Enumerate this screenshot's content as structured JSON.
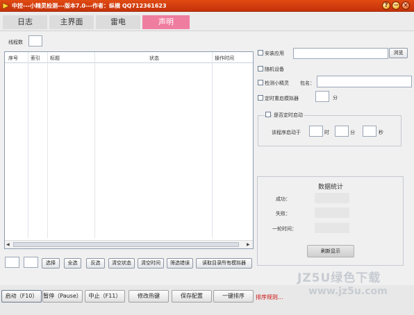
{
  "window": {
    "title": "中控---小精灵检测---版本7.0---作者：纵横 QQ712361623",
    "title_color": "#d63c0c"
  },
  "tabs": [
    {
      "label": "日志",
      "active": false
    },
    {
      "label": "主界面",
      "active": false
    },
    {
      "label": "雷电",
      "active": false
    },
    {
      "label": "声明",
      "active": true
    }
  ],
  "threads": {
    "label": "线程数",
    "value": ""
  },
  "table": {
    "columns": [
      "序号",
      "索引",
      "标题",
      "状态",
      "操作时间"
    ],
    "rows": []
  },
  "options": {
    "install_app": {
      "label": "安装应用",
      "checked": false,
      "value": ""
    },
    "browse_button": "浏览",
    "random_device": {
      "label": "随机设备",
      "checked": false
    },
    "detect_sprite": {
      "label": "检测小精灵",
      "checked": false,
      "pkg_label": "包名：",
      "pkg_value": ""
    },
    "timed_restart": {
      "label": "定时重启模拟器",
      "checked": false,
      "value": "",
      "unit": "分"
    }
  },
  "schedule": {
    "label": "是否定时启动",
    "checked": false,
    "prefix": "该程序启动于",
    "hour_unit": "时",
    "minute_unit": "分",
    "second_unit": "秒"
  },
  "stats": {
    "title": "数据统计",
    "success_label": "成功：",
    "fail_label": "失败：",
    "round_time_label": "一轮时间：",
    "refresh_button": "刷新显示"
  },
  "list_actions": {
    "select_button": "选择",
    "select_all_button": "全选",
    "invert_button": "反选",
    "clear_status_button": "清空状态",
    "clear_time_button": "清空时间",
    "filter_error_button": "筛选错误",
    "read_all_button": "读取目录所有模拟器"
  },
  "bottom": {
    "start_button": "启动（F10）",
    "pause_button": "暂停（Pause）",
    "stop_button": "中止（F11）",
    "hotkey_button": "修改热键",
    "save_button": "保存配置",
    "sort_button": "一键排序",
    "sort_rule_text": "排序规则...",
    "sort_rule_color": "#cc1111"
  },
  "watermark": {
    "line1": "JZ5U绿色下载",
    "line2": "www.jz5u.com"
  }
}
